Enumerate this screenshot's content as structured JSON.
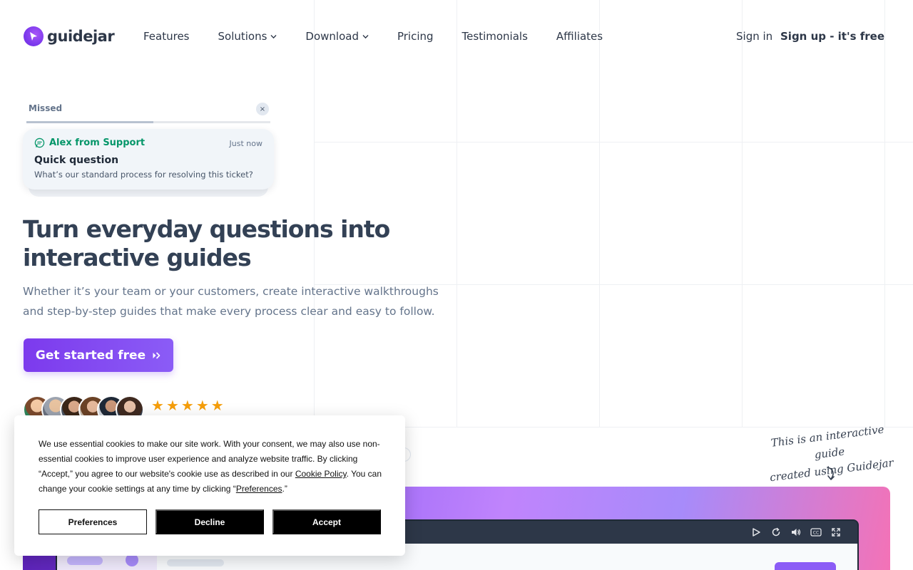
{
  "brand": {
    "name": "guidejar",
    "accent": "#7c3aed"
  },
  "nav": {
    "items": [
      {
        "label": "Features",
        "dropdown": false
      },
      {
        "label": "Solutions",
        "dropdown": true
      },
      {
        "label": "Download",
        "dropdown": true
      },
      {
        "label": "Pricing",
        "dropdown": false
      },
      {
        "label": "Testimonials",
        "dropdown": false
      },
      {
        "label": "Affiliates",
        "dropdown": false
      }
    ],
    "signin": "Sign in",
    "signup": "Sign up - it's free"
  },
  "notification": {
    "status": "Missed",
    "close_icon": "×",
    "progress": 0.52,
    "sender": "Alex from Support",
    "time": "Just now",
    "title": "Quick question",
    "body": "What’s our standard process for resolving this ticket?"
  },
  "hero": {
    "title": "Turn everyday questions into interactive guides",
    "subtitle": "Whether it’s your team or your customers, create interactive walkthroughs and step-by-step guides that make every process clear and easy to follow.",
    "cta": "Get started free",
    "rating": 5
  },
  "annotation": {
    "line1": "This is an interactive guide",
    "line2": "created using Guidejar"
  },
  "cookie": {
    "text_before": "We use essential cookies to make our site work. With your consent, we may also use non-essential cookies to improve user experience and analyze website traffic. By clicking “Accept,” you agree to our website's cookie use as described in our ",
    "policy_link": "Cookie Policy",
    "text_middle": ". You can change your cookie settings at any time by clicking “",
    "prefs_link": "Preferences",
    "text_end": ".”",
    "buttons": {
      "preferences": "Preferences",
      "decline": "Decline",
      "accept": "Accept"
    }
  },
  "demo": {
    "controls": [
      "play-icon",
      "replay-icon",
      "volume-icon",
      "captions-icon",
      "fullscreen-icon"
    ],
    "captions_label": "CC"
  }
}
